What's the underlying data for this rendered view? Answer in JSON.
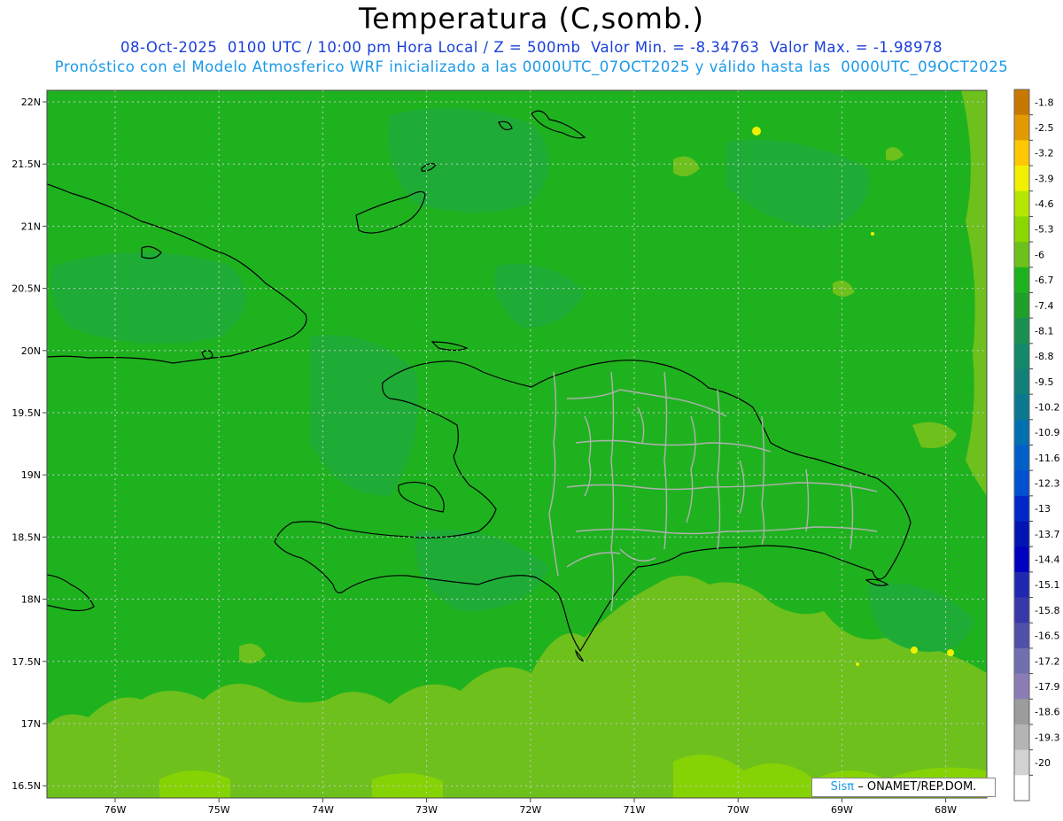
{
  "header": {
    "title": "Temperatura (C,somb.)",
    "subtitle_1": "08-Oct-2025  0100 UTC / 10:00 pm Hora Local / Z = 500mb  Valor Min. = -8.34763  Valor Max. = -1.98978",
    "subtitle_2": "Pronóstico con el Modelo Atmosferico WRF inicializado a las 0000UTC_07OCT2025 y válido hasta las  0000UTC_09OCT2025"
  },
  "map": {
    "lat_labels": [
      "22N",
      "21.5N",
      "21N",
      "20.5N",
      "20N",
      "19.5N",
      "19N",
      "18.5N",
      "18N",
      "17.5N",
      "17N",
      "16.5N"
    ],
    "lon_labels": [
      "76W",
      "75W",
      "74W",
      "73W",
      "72W",
      "71W",
      "70W",
      "69W",
      "68W"
    ],
    "colors": {
      "background_field": "#1fb21f",
      "warmer_field": "#6ec01c",
      "cooler_patch": "#1ea84a",
      "coast": "#000000",
      "province_border": "#b0b0b0"
    }
  },
  "colorbar": {
    "labels": [
      "-1.8",
      "-2.5",
      "-3.2",
      "-3.9",
      "-4.6",
      "-5.3",
      "-6",
      "-6.7",
      "-7.4",
      "-8.1",
      "-8.8",
      "-9.5",
      "-10.2",
      "-10.9",
      "-11.6",
      "-12.3",
      "-13",
      "-13.7",
      "-14.4",
      "-15.1",
      "-15.8",
      "-16.5",
      "-17.2",
      "-17.9",
      "-18.6",
      "-19.3",
      "-20"
    ],
    "colors": [
      "#c87800",
      "#e19b00",
      "#ffc800",
      "#f0f000",
      "#b4e600",
      "#8cd700",
      "#6ec01c",
      "#1fb21f",
      "#1ea02a",
      "#1a9050",
      "#14886a",
      "#108078",
      "#0c7890",
      "#0070b0",
      "#0060c8",
      "#0050d2",
      "#0028c8",
      "#0014b4",
      "#0000c0",
      "#2028b0",
      "#3838a8",
      "#5050a8",
      "#7070b0",
      "#8c7cb4",
      "#9c9c9c",
      "#b4b4b4",
      "#d2d2d2",
      "#ffffff"
    ]
  },
  "credit": {
    "logo_text": "Sisπ",
    "text": "– ONAMET/REP.DOM."
  }
}
